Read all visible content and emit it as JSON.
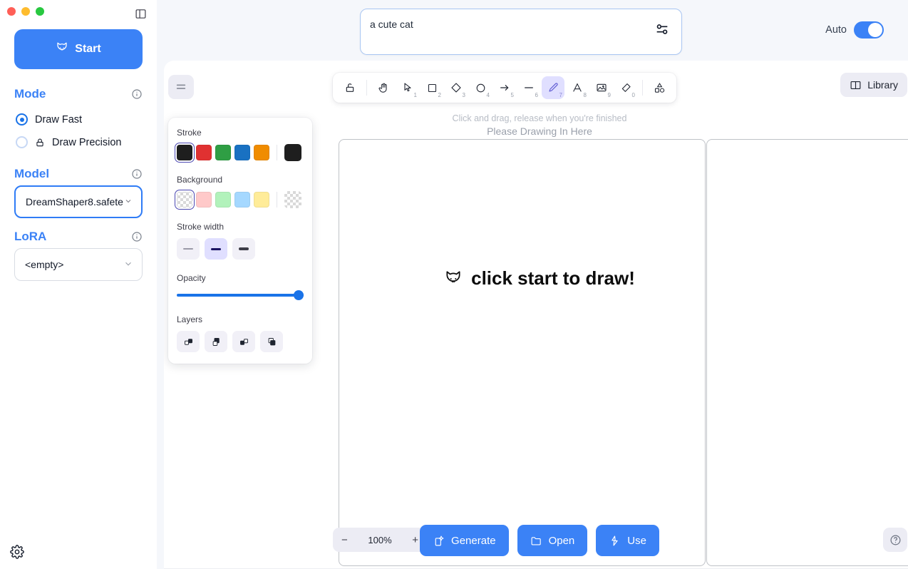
{
  "window": {
    "traffic_lights": [
      "close",
      "minimize",
      "maximize"
    ],
    "panel_toggle_icon": "sidebar-toggle-icon"
  },
  "sidebar": {
    "start_button": {
      "label": "Start",
      "icon": "cat-icon"
    },
    "mode": {
      "title": "Mode",
      "info_icon": "info-icon",
      "options": [
        {
          "label": "Draw Fast",
          "selected": true,
          "icon": ""
        },
        {
          "label": "Draw Precision",
          "selected": false,
          "icon": "lock-icon"
        }
      ]
    },
    "model": {
      "title": "Model",
      "info_icon": "info-icon",
      "value": "DreamShaper8.safete",
      "chevron": "chevron-down-icon"
    },
    "lora": {
      "title": "LoRA",
      "info_icon": "info-icon",
      "value": "<empty>",
      "chevron": "chevron-down-icon"
    },
    "settings_icon": "gear-icon"
  },
  "header": {
    "prompt": {
      "value": "a cute cat",
      "placeholder": "",
      "settings_icon": "sliders-icon"
    },
    "auto": {
      "label": "Auto",
      "enabled": true
    }
  },
  "toolbar": {
    "menu_icon": "hamburger-menu-icon",
    "library_button": {
      "label": "Library",
      "icon": "book-icon"
    },
    "tools": [
      {
        "name": "lock-tool",
        "icon": "lock-open-icon",
        "key": "",
        "active": false,
        "sep_after": true
      },
      {
        "name": "hand-tool",
        "icon": "hand-icon",
        "key": "",
        "active": false,
        "sep_after": false
      },
      {
        "name": "select-tool",
        "icon": "cursor-icon",
        "key": "1",
        "active": false,
        "sep_after": false
      },
      {
        "name": "rectangle-tool",
        "icon": "square-icon",
        "key": "2",
        "active": false,
        "sep_after": false
      },
      {
        "name": "diamond-tool",
        "icon": "diamond-icon",
        "key": "3",
        "active": false,
        "sep_after": false
      },
      {
        "name": "ellipse-tool",
        "icon": "circle-icon",
        "key": "4",
        "active": false,
        "sep_after": false
      },
      {
        "name": "arrow-tool",
        "icon": "arrow-icon",
        "key": "5",
        "active": false,
        "sep_after": false
      },
      {
        "name": "line-tool",
        "icon": "line-icon",
        "key": "6",
        "active": false,
        "sep_after": false
      },
      {
        "name": "draw-tool",
        "icon": "pencil-icon",
        "key": "7",
        "active": true,
        "sep_after": false
      },
      {
        "name": "text-tool",
        "icon": "text-icon",
        "key": "8",
        "active": false,
        "sep_after": false
      },
      {
        "name": "image-tool",
        "icon": "image-icon",
        "key": "9",
        "active": false,
        "sep_after": false
      },
      {
        "name": "eraser-tool",
        "icon": "eraser-icon",
        "key": "0",
        "active": false,
        "sep_after": true
      },
      {
        "name": "shapes-tool",
        "icon": "shapes-icon",
        "key": "",
        "active": false,
        "sep_after": false
      }
    ]
  },
  "properties": {
    "stroke": {
      "label": "Stroke",
      "colors": [
        "#1e1e1e",
        "#e03131",
        "#2f9e44",
        "#1971c2",
        "#f08c00"
      ],
      "selected_index": 0,
      "current": "#1e1e1e"
    },
    "background": {
      "label": "Background",
      "colors": [
        "transparent",
        "#ffc9c9",
        "#b2f2bb",
        "#a5d8ff",
        "#ffec99"
      ],
      "selected_index": 0,
      "current": "transparent"
    },
    "stroke_width": {
      "label": "Stroke width",
      "options": [
        "thin",
        "bold",
        "extra-bold"
      ],
      "selected_index": 1
    },
    "opacity": {
      "label": "Opacity",
      "value": 100
    },
    "layers": {
      "label": "Layers",
      "buttons": [
        "send-to-back-icon",
        "send-backward-icon",
        "bring-forward-icon",
        "bring-to-front-icon"
      ]
    }
  },
  "canvas": {
    "hint_top": "Click and drag, release when you're finished",
    "hint_sub": "Please Drawing In Here",
    "center_text": "click start to draw!",
    "center_icon": "cat-icon"
  },
  "footer": {
    "zoom": {
      "value": "100%",
      "minus": "−",
      "plus": "+"
    },
    "history": {
      "undo_icon": "undo-icon",
      "redo_icon": "redo-icon"
    },
    "actions": [
      {
        "name": "generate-button",
        "label": "Generate",
        "icon": "generate-icon"
      },
      {
        "name": "open-button",
        "label": "Open",
        "icon": "folder-icon"
      },
      {
        "name": "use-button",
        "label": "Use",
        "icon": "use-icon"
      }
    ],
    "help_icon": "help-icon"
  },
  "colors": {
    "accent": "#3b82f6",
    "panel_bg": "#f5f7fb",
    "active_tool": "#e0dfff"
  }
}
